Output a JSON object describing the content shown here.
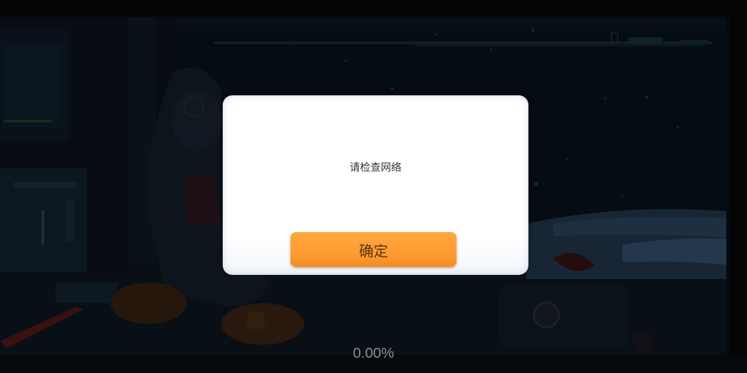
{
  "dialog": {
    "message": "请检查网络",
    "confirm_label": "确定"
  },
  "loading": {
    "progress_text": "0.00%",
    "progress": 0.0
  },
  "colors": {
    "button": "#ff9f38",
    "dialog_bg": "#ffffff",
    "message_text": "#333333",
    "progress_text": "#8a8f96"
  },
  "icons": {
    "hud": "battery-icon"
  }
}
